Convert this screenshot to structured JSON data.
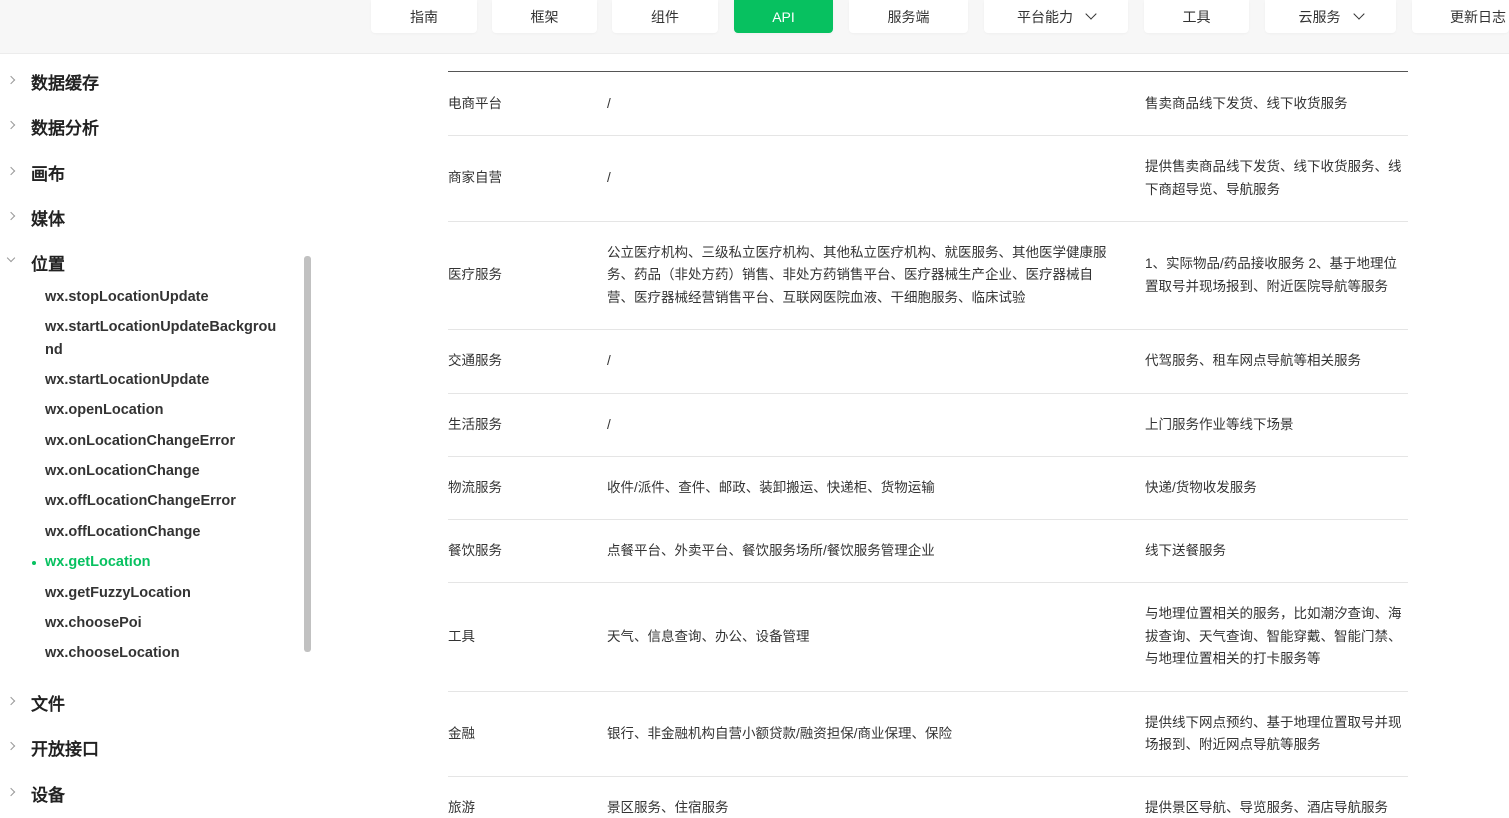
{
  "nav": {
    "items": [
      {
        "label": "指南",
        "active": false,
        "dropdown": false
      },
      {
        "label": "框架",
        "active": false,
        "dropdown": false
      },
      {
        "label": "组件",
        "active": false,
        "dropdown": false
      },
      {
        "label": "API",
        "active": true,
        "dropdown": false
      },
      {
        "label": "服务端",
        "active": false,
        "dropdown": false
      },
      {
        "label": "平台能力",
        "active": false,
        "dropdown": true
      },
      {
        "label": "工具",
        "active": false,
        "dropdown": false
      },
      {
        "label": "云服务",
        "active": false,
        "dropdown": true
      },
      {
        "label": "更新日志",
        "active": false,
        "dropdown": false
      }
    ]
  },
  "sidebar": {
    "categories": [
      {
        "label": "数据缓存",
        "open": false
      },
      {
        "label": "数据分析",
        "open": false
      },
      {
        "label": "画布",
        "open": false
      },
      {
        "label": "媒体",
        "open": false
      },
      {
        "label": "位置",
        "open": true
      },
      {
        "label": "文件",
        "open": false
      },
      {
        "label": "开放接口",
        "open": false
      },
      {
        "label": "设备",
        "open": false
      }
    ],
    "location_items": [
      {
        "label": "wx.stopLocationUpdate",
        "active": false
      },
      {
        "label": "wx.startLocationUpdateBackground",
        "active": false
      },
      {
        "label": "wx.startLocationUpdate",
        "active": false
      },
      {
        "label": "wx.openLocation",
        "active": false
      },
      {
        "label": "wx.onLocationChangeError",
        "active": false
      },
      {
        "label": "wx.onLocationChange",
        "active": false
      },
      {
        "label": "wx.offLocationChangeError",
        "active": false
      },
      {
        "label": "wx.offLocationChange",
        "active": false
      },
      {
        "label": "wx.getLocation",
        "active": true
      },
      {
        "label": "wx.getFuzzyLocation",
        "active": false
      },
      {
        "label": "wx.choosePoi",
        "active": false
      },
      {
        "label": "wx.chooseLocation",
        "active": false
      }
    ]
  },
  "table": {
    "rows": [
      {
        "category": "电商平台",
        "subjects": "/",
        "scene": "售卖商品线下发货、线下收货服务"
      },
      {
        "category": "商家自营",
        "subjects": "/",
        "scene": "提供售卖商品线下发货、线下收货服务、线下商超导览、导航服务"
      },
      {
        "category": "医疗服务",
        "subjects": "公立医疗机构、三级私立医疗机构、其他私立医疗机构、就医服务、其他医学健康服务、药品（非处方药）销售、非处方药销售平台、医疗器械生产企业、医疗器械自营、医疗器械经营销售平台、互联网医院血液、干细胞服务、临床试验",
        "scene": "1、实际物品/药品接收服务 2、基于地理位置取号并现场报到、附近医院导航等服务"
      },
      {
        "category": "交通服务",
        "subjects": "/",
        "scene": "代驾服务、租车网点导航等相关服务"
      },
      {
        "category": "生活服务",
        "subjects": "/",
        "scene": "上门服务作业等线下场景"
      },
      {
        "category": "物流服务",
        "subjects": "收件/派件、查件、邮政、装卸搬运、快递柜、货物运输",
        "scene": "快递/货物收发服务"
      },
      {
        "category": "餐饮服务",
        "subjects": "点餐平台、外卖平台、餐饮服务场所/餐饮服务管理企业",
        "scene": "线下送餐服务"
      },
      {
        "category": "工具",
        "subjects": "天气、信息查询、办公、设备管理",
        "scene": "与地理位置相关的服务，比如潮汐查询、海拔查询、天气查询、智能穿戴、智能门禁、与地理位置相关的打卡服务等"
      },
      {
        "category": "金融",
        "subjects": "银行、非金融机构自营小额贷款/融资担保/商业保理、保险",
        "scene": "提供线下网点预约、基于地理位置取号并现场报到、附近网点导航等服务"
      },
      {
        "category": "旅游",
        "subjects": "景区服务、住宿服务",
        "scene": "提供景区导航、导览服务、酒店导航服务"
      }
    ]
  },
  "colors": {
    "accent": "#07c160",
    "divider": "#e5e5e5",
    "text": "#333333"
  }
}
